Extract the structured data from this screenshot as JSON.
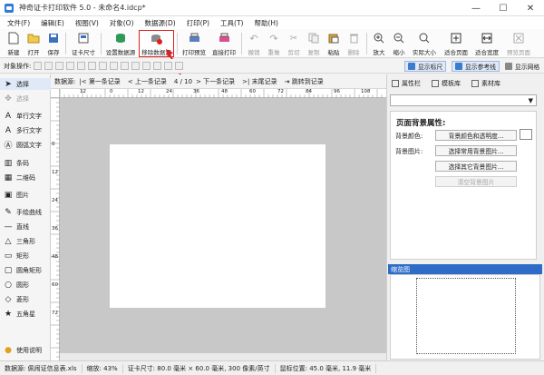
{
  "window": {
    "title": "神奇证卡打印软件 5.0 - 未命名4.idcp*",
    "min": "—",
    "max": "☐",
    "close": "✕"
  },
  "menu": [
    "文件(F)",
    "编辑(E)",
    "视图(V)",
    "对象(O)",
    "数据源(D)",
    "打印(P)",
    "工具(T)",
    "帮助(H)"
  ],
  "toolbar": {
    "new": "新建",
    "open": "打开",
    "save": "保存",
    "cardsize": "证卡尺寸",
    "setds": "设置数据源",
    "removeds": "移除数据源",
    "preview": "打印预览",
    "print": "直接打印",
    "undo": "撤销",
    "redo": "重做",
    "cut": "剪切",
    "copy": "复制",
    "paste": "粘贴",
    "delete": "删除",
    "zoomin": "放大",
    "zoomout": "缩小",
    "actual": "实际大小",
    "fitpage": "适合页面",
    "fitwidth": "适合宽度",
    "prevpage": "预览页面"
  },
  "objbar": {
    "label": "对象操作:",
    "ruler": "显示标尺",
    "guide": "显示参考线",
    "grid": "显示网格"
  },
  "tools": [
    "选择",
    "选择",
    "单行文字",
    "多行文字",
    "圆弧文字",
    "条码",
    "二维码",
    "图片",
    "手绘曲线",
    "直线",
    "三角形",
    "矩形",
    "圆角矩形",
    "圆形",
    "菱形",
    "五角星",
    "使用说明"
  ],
  "recnav": {
    "ds": "数据源:",
    "first": "第一条记录",
    "prev": "上一条记录",
    "pos": "4 / 10",
    "next": "下一条记录",
    "last": "末尾记录",
    "jump": "跳转到记录"
  },
  "ruler": {
    "h": [
      "12",
      "0",
      "12",
      "24",
      "36",
      "48",
      "60",
      "72",
      "84",
      "96",
      "108"
    ],
    "v": [
      "0",
      "12",
      "24",
      "36",
      "48",
      "60",
      "72"
    ]
  },
  "right": {
    "tabs": [
      "属性栏",
      "模板库",
      "素材库"
    ],
    "section_title": "页面背景属性:",
    "bgcolor_label": "背景颜色:",
    "bgcolor_btn": "背景颜色和透明度...",
    "bgimage_label": "背景图片:",
    "btn_common": "选择常用背景图片...",
    "btn_other": "选择其它背景图片...",
    "btn_clear": "清空背景图片",
    "preview_title": "缩览图"
  },
  "status": [
    "数据源: 佩闹证信息表.xls",
    "缩放: 43%",
    "证卡尺寸: 80.0 毫米 × 60.0 毫米, 300 像素/英寸",
    "鼠标位置: 45.0 毫米, 11.9 毫米"
  ],
  "colors": {
    "accent": "#2e6cc8",
    "highlight": "#e02020"
  }
}
